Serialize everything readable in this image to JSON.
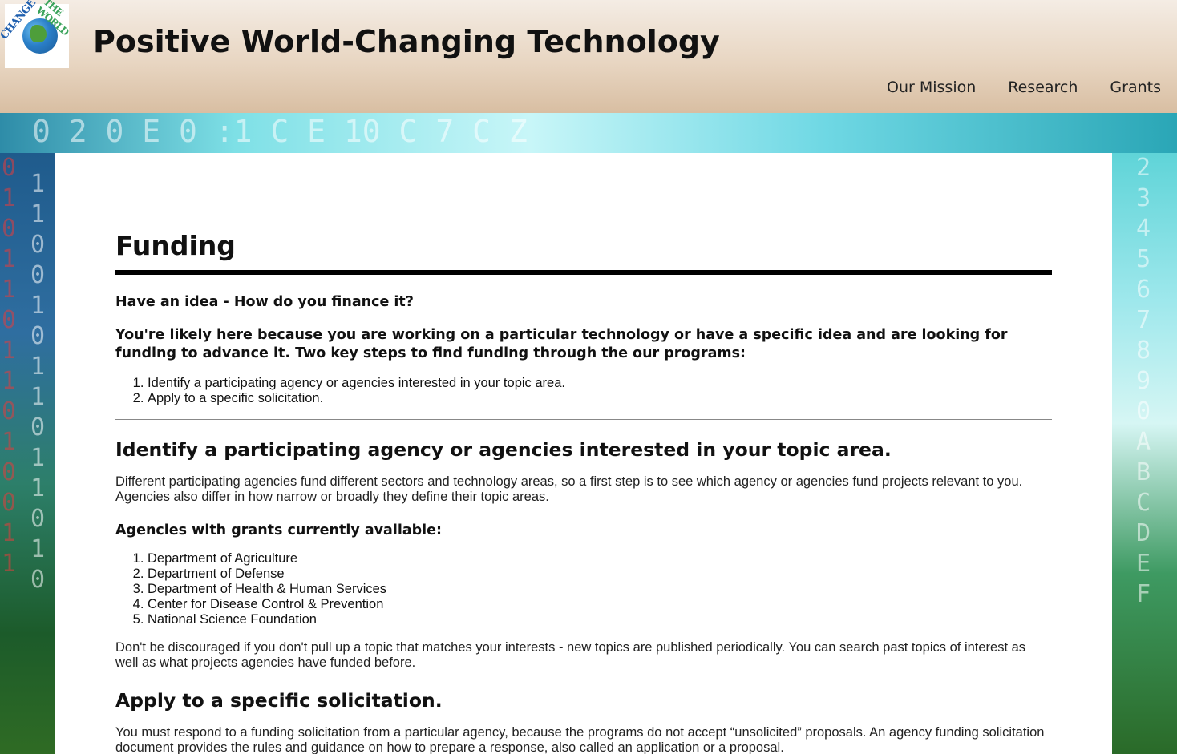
{
  "header": {
    "logo_text_a": "CHANGE",
    "logo_text_b": "THE WORLD",
    "site_title": "Positive World-Changing Technology",
    "nav": [
      "Our Mission",
      "Research",
      "Grants"
    ]
  },
  "colors": {
    "header_top": "#f4ece4",
    "header_bottom": "#d8bea2",
    "rule": "#000000",
    "text": "#111111"
  },
  "background": {
    "top_glyphs": "0 2  0 E 0   :1   C  E 10  C 7  C  Z",
    "left_glyphs": [
      "0",
      "1",
      "0",
      "1",
      "1",
      "0",
      "1",
      "1",
      "0",
      "1",
      "0",
      "0",
      "1",
      "1"
    ],
    "right_glyphs": [
      "2",
      "3",
      "4",
      "5",
      "6",
      "7",
      "8",
      "9",
      "0",
      "A",
      "B",
      "C",
      "D",
      "E",
      "F"
    ]
  },
  "main": {
    "title": "Funding",
    "question": "Have an idea - How do you finance it?",
    "intro": "You're likely here because you are working on a particular technology or have a specific idea and are looking for funding to advance it. Two key steps to find funding through the our programs:",
    "steps": [
      "Identify a participating agency or agencies interested in your topic area.",
      "Apply to a specific solicitation."
    ],
    "section1": {
      "heading": "Identify a participating agency or agencies interested in your topic area.",
      "paragraph": "Different participating agencies fund different sectors and technology areas, so a first step is to see which agency or agencies fund projects relevant to you. Agencies also differ in how narrow or broadly they define their topic areas.",
      "subheading": "Agencies with grants currently available:",
      "agencies": [
        "Department of Agriculture",
        "Department of Defense",
        "Department of Health & Human Services",
        "Center for Disease Control & Prevention",
        "National Science Foundation"
      ],
      "note": "Don't be discouraged if you don't pull up a topic that matches your interests - new topics are published periodically. You can search past topics of interest as well as what projects agencies have funded before."
    },
    "section2": {
      "heading": "Apply to a specific solicitation.",
      "paragraph": "You must respond to a funding solicitation from a particular agency, because the programs do not accept “unsolicited” proposals. An agency funding solicitation document provides the rules and guidance on how to prepare a response, also called an application or a proposal."
    }
  }
}
